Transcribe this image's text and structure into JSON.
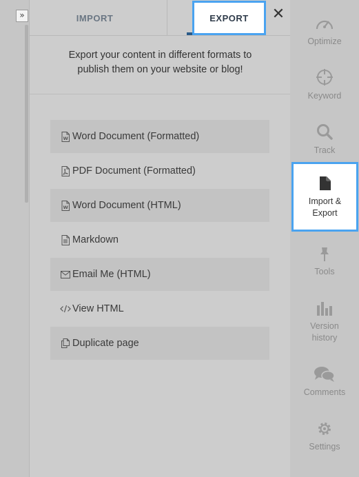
{
  "collapse": {
    "glyph": "»"
  },
  "tabs": {
    "import": "IMPORT",
    "export": "EXPORT",
    "close": "✕"
  },
  "description": {
    "line1": "Export your content in different formats to",
    "line2": "publish them on your website or blog!"
  },
  "export_options": [
    {
      "label": "Word Document (Formatted)",
      "icon": "word-doc-icon"
    },
    {
      "label": "PDF Document (Formatted)",
      "icon": "pdf-doc-icon"
    },
    {
      "label": "Word Document (HTML)",
      "icon": "word-doc-icon"
    },
    {
      "label": "Markdown",
      "icon": "text-doc-icon"
    },
    {
      "label": "Email Me (HTML)",
      "icon": "envelope-icon"
    },
    {
      "label": "View HTML",
      "icon": "code-icon"
    },
    {
      "label": "Duplicate page",
      "icon": "copy-icon"
    }
  ],
  "nav": {
    "optimize": "Optimize",
    "keyword": "Keyword",
    "track": "Track",
    "import_export_1": "Import &",
    "import_export_2": "Export",
    "tools": "Tools",
    "version_1": "Version",
    "version_2": "history",
    "comments": "Comments",
    "settings": "Settings"
  },
  "colors": {
    "accent_border": "#4aa3f0",
    "tab_underline": "#2a5a88"
  }
}
